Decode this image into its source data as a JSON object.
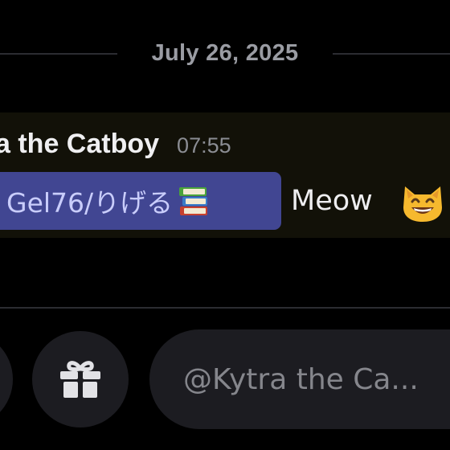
{
  "divider": {
    "date": "July 26, 2025"
  },
  "message": {
    "author": "a the Catboy",
    "timestamp": "07:55",
    "mention": "Gel76/りげる",
    "mention_emoji": "books-icon",
    "text": "Meow",
    "trailing_emoji": "grinning-cat-icon"
  },
  "composer": {
    "placeholder": "@Kytra the Ca...",
    "gift_icon": "gift-icon"
  },
  "colors": {
    "background": "#000000",
    "highlight_background": "#121108",
    "mention_background": "#414692",
    "mention_text": "#c9cdfb",
    "control_background": "#1c1c21",
    "muted_text": "#8b8d93"
  }
}
